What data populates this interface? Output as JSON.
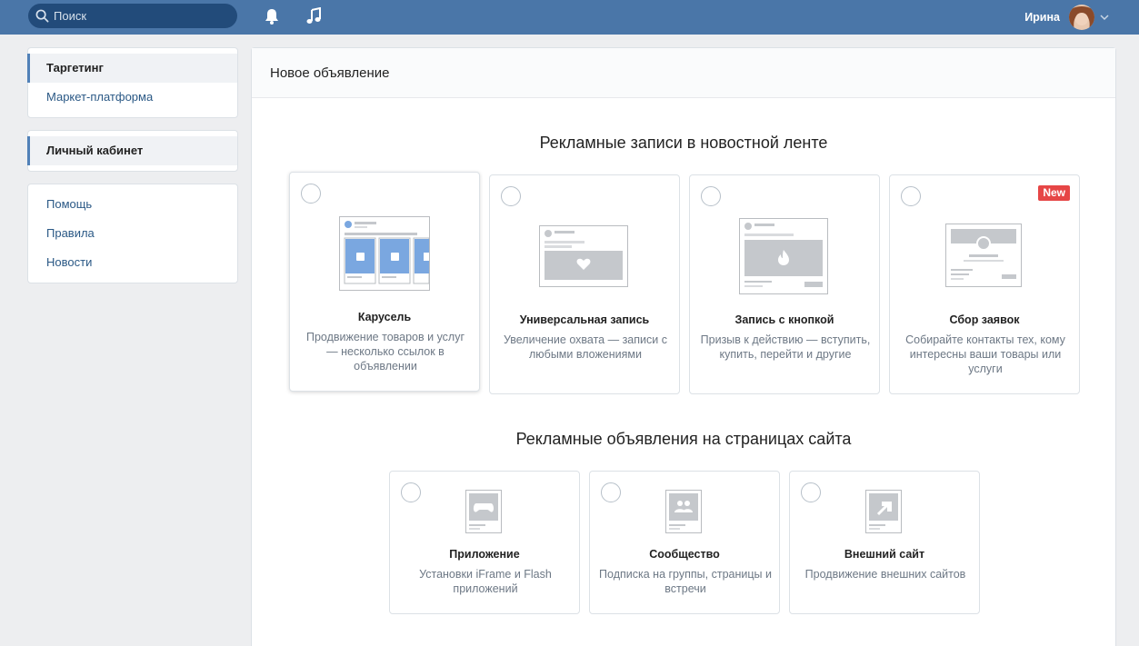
{
  "header": {
    "search_placeholder": "Поиск",
    "user_name": "Ирина",
    "icons": [
      "search-icon",
      "bell-icon",
      "music-icon",
      "chevron-down-icon"
    ]
  },
  "sidebar": {
    "block1": [
      {
        "label": "Таргетинг",
        "active": true
      },
      {
        "label": "Маркет-платформа",
        "active": false
      }
    ],
    "block2": [
      {
        "label": "Личный кабинет",
        "active": true
      }
    ],
    "block3": [
      {
        "label": "Помощь",
        "active": false
      },
      {
        "label": "Правила",
        "active": false
      },
      {
        "label": "Новости",
        "active": false
      }
    ]
  },
  "main": {
    "title": "Новое объявление",
    "section1": {
      "title": "Рекламные записи в новостной ленте",
      "cards": [
        {
          "title": "Карусель",
          "desc": "Продвижение товаров и услуг — несколько ссылок в объявлении",
          "badge": ""
        },
        {
          "title": "Универсальная запись",
          "desc": "Увеличение охвата — записи с любыми вложениями",
          "badge": ""
        },
        {
          "title": "Запись с кнопкой",
          "desc": "Призыв к действию — вступить, купить, перейти и другие",
          "badge": ""
        },
        {
          "title": "Сбор заявок",
          "desc": "Собирайте контакты тех, кому интересны ваши товары или услуги",
          "badge": "New"
        }
      ]
    },
    "section2": {
      "title": "Рекламные объявления на страницах сайта",
      "cards": [
        {
          "title": "Приложение",
          "desc": "Установки iFrame и Flash приложений"
        },
        {
          "title": "Сообщество",
          "desc": "Подписка на группы, страницы и встречи"
        },
        {
          "title": "Внешний сайт",
          "desc": "Продвижение внешних сайтов"
        }
      ]
    }
  },
  "colors": {
    "topbar": "#4a76a8",
    "accent": "#5181b8",
    "badge": "#e64646",
    "illustration": "#c5c8cc",
    "carousel": "#7aa7e0"
  }
}
